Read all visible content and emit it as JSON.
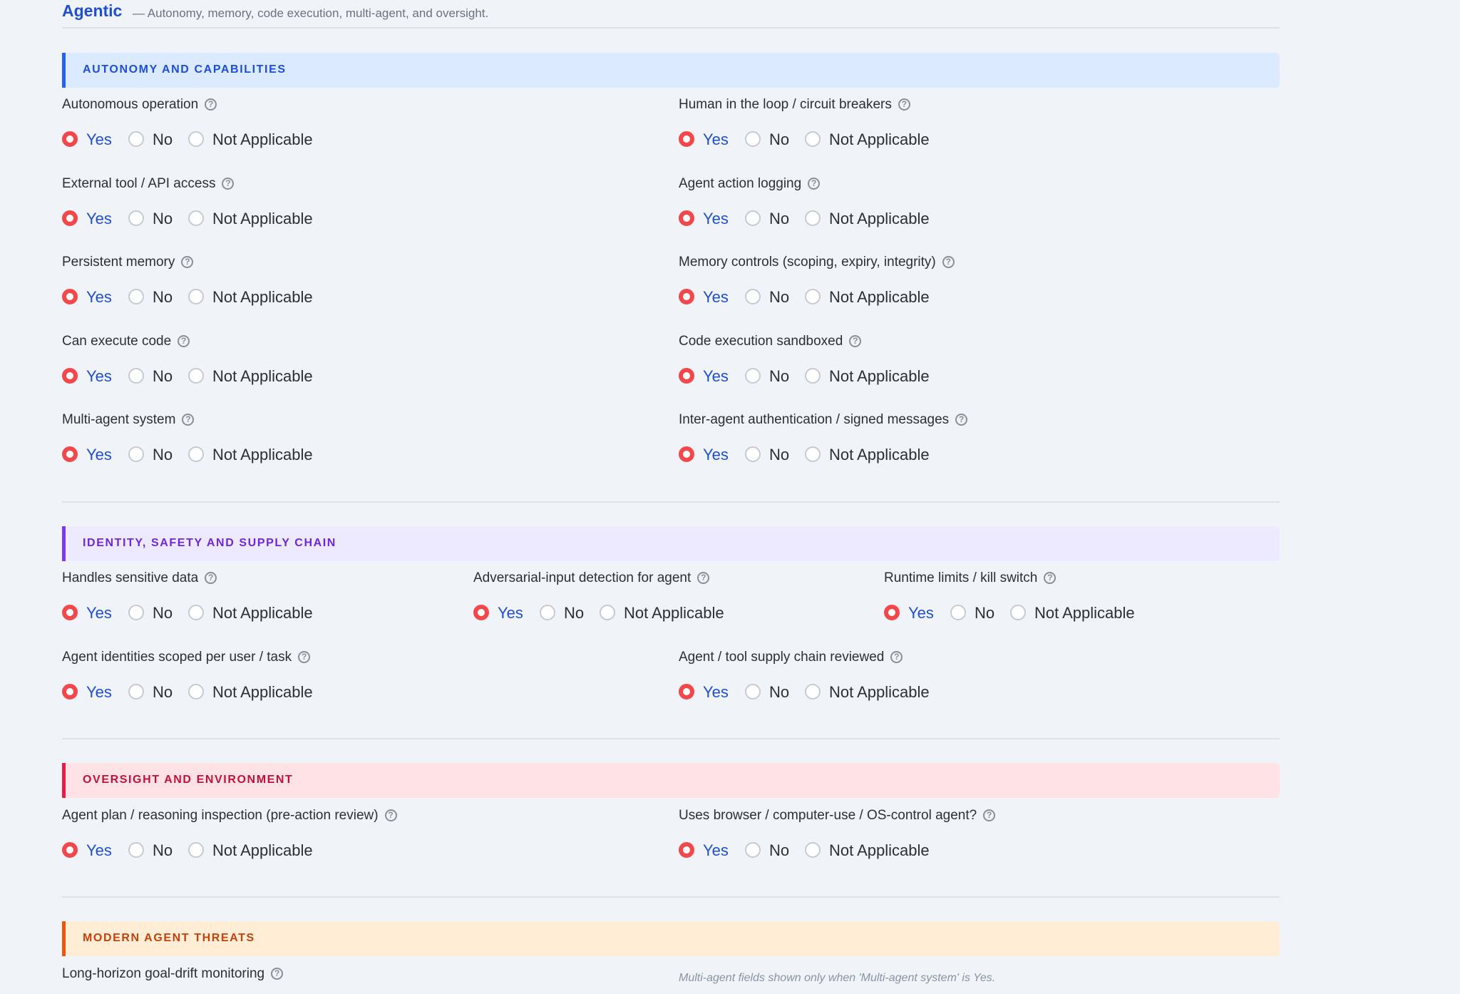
{
  "header": {
    "title": "Agentic",
    "subtitle": "— Autonomy, memory, code execution, multi-agent, and oversight."
  },
  "options": {
    "yes": "Yes",
    "no": "No",
    "na": "Not Applicable"
  },
  "help_glyph": "?",
  "colors": {
    "accent": "#1f4fd1",
    "selected_radio": "#f2484c"
  },
  "sections": [
    {
      "title": "AUTONOMY AND CAPABILITIES",
      "fields": [
        {
          "label": "Autonomous operation",
          "value": "Yes"
        },
        {
          "label": "Human in the loop / circuit breakers",
          "value": "Yes"
        },
        {
          "label": "External tool / API access",
          "value": "Yes"
        },
        {
          "label": "Agent action logging",
          "value": "Yes"
        },
        {
          "label": "Persistent memory",
          "value": "Yes"
        },
        {
          "label": "Memory controls (scoping, expiry, integrity)",
          "value": "Yes"
        },
        {
          "label": "Can execute code",
          "value": "Yes"
        },
        {
          "label": "Code execution sandboxed",
          "value": "Yes"
        },
        {
          "label": "Multi-agent system",
          "value": "Yes"
        },
        {
          "label": "Inter-agent authentication / signed messages",
          "value": "Yes"
        }
      ]
    },
    {
      "title": "IDENTITY, SAFETY AND SUPPLY CHAIN",
      "fields": [
        {
          "label": "Handles sensitive data",
          "value": "Yes"
        },
        {
          "label": "Adversarial-input detection for agent",
          "value": "Yes"
        },
        {
          "label": "Runtime limits / kill switch",
          "value": "Yes"
        },
        {
          "label": "Agent identities scoped per user / task",
          "value": "Yes"
        },
        {
          "label": "Agent / tool supply chain reviewed",
          "value": "Yes"
        }
      ]
    },
    {
      "title": "OVERSIGHT AND ENVIRONMENT",
      "fields": [
        {
          "label": "Agent plan / reasoning inspection (pre-action review)",
          "value": "Yes"
        },
        {
          "label": "Uses browser / computer-use / OS-control agent?",
          "value": "Yes"
        }
      ]
    },
    {
      "title": "MODERN AGENT THREATS",
      "fields": [
        {
          "label": "Long-horizon goal-drift monitoring"
        }
      ],
      "note": "Multi-agent fields shown only when 'Multi-agent system' is Yes."
    }
  ]
}
